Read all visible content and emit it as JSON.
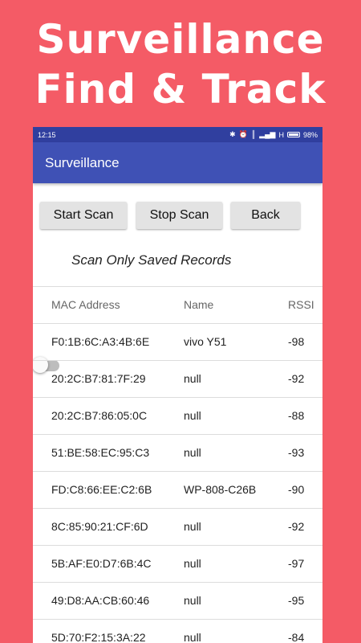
{
  "promo": {
    "line1": "Surveillance",
    "line2": "Find & Track"
  },
  "status_bar": {
    "time": "12:15",
    "network": "H",
    "battery": "98%",
    "icons": [
      "bluetooth-icon",
      "alarm-icon",
      "vibrate-icon",
      "signal-icon",
      "battery-icon"
    ]
  },
  "app_bar": {
    "title": "Surveillance"
  },
  "buttons": {
    "start": "Start Scan",
    "stop": "Stop Scan",
    "back": "Back"
  },
  "toggle": {
    "label": "Scan Only Saved Records",
    "checked": false
  },
  "table": {
    "headers": {
      "mac": "MAC Address",
      "name": "Name",
      "rssi": "RSSI"
    },
    "rows": [
      {
        "mac": "F0:1B:6C:A3:4B:6E",
        "name": "vivo Y51",
        "rssi": "-98"
      },
      {
        "mac": "20:2C:B7:81:7F:29",
        "name": "null",
        "rssi": "-92"
      },
      {
        "mac": "20:2C:B7:86:05:0C",
        "name": "null",
        "rssi": "-88"
      },
      {
        "mac": "51:BE:58:EC:95:C3",
        "name": "null",
        "rssi": "-93"
      },
      {
        "mac": "FD:C8:66:EE:C2:6B",
        "name": "WP-808-C26B",
        "rssi": "-90"
      },
      {
        "mac": "8C:85:90:21:CF:6D",
        "name": "null",
        "rssi": "-92"
      },
      {
        "mac": "5B:AF:E0:D7:6B:4C",
        "name": "null",
        "rssi": "-97"
      },
      {
        "mac": "49:D8:AA:CB:60:46",
        "name": "null",
        "rssi": "-95"
      },
      {
        "mac": "5D:70:F2:15:3A:22",
        "name": "null",
        "rssi": "-84"
      }
    ]
  },
  "colors": {
    "background": "#f45b66",
    "status_bar": "#303f9f",
    "app_bar": "#3f51b5",
    "button": "#e3e3e3"
  }
}
